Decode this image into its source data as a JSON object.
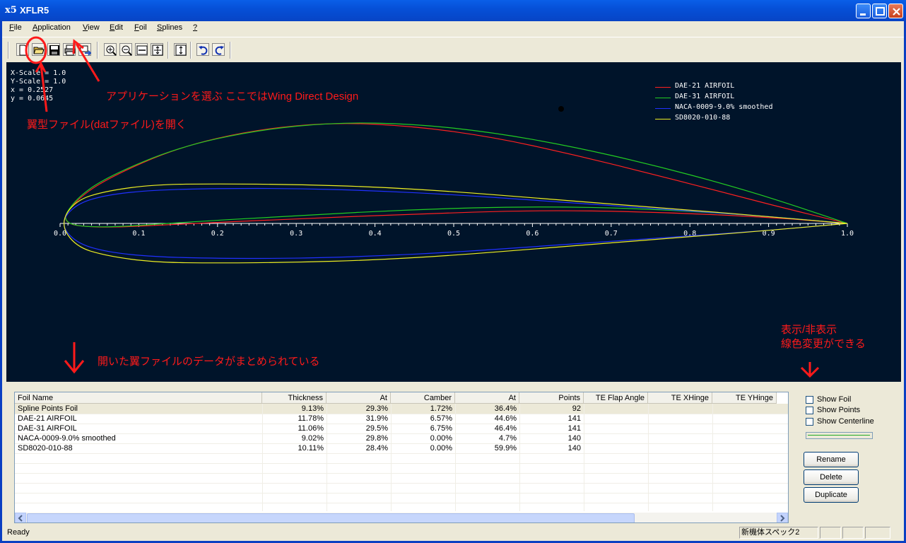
{
  "window": {
    "title": "XFLR5",
    "icon": "x5-app-icon"
  },
  "menu": [
    {
      "label": "File",
      "u": "F",
      "rest": "ile"
    },
    {
      "label": "Application",
      "u": "A",
      "rest": "pplication"
    },
    {
      "label": "View",
      "u": "V",
      "rest": "iew"
    },
    {
      "label": "Edit",
      "u": "E",
      "rest": "dit"
    },
    {
      "label": "Foil",
      "u": "F",
      "rest": "oil"
    },
    {
      "label": "Splines",
      "u": "S",
      "rest": "plines"
    },
    {
      "label": "?",
      "u": "?",
      "rest": ""
    }
  ],
  "toolbar_icons": [
    "new-icon",
    "open-icon",
    "save-icon",
    "print-icon",
    "export-icon",
    "zoom-in-icon",
    "zoom-out-icon",
    "zoom-less-icon",
    "reset-scale-icon",
    "y-scale-icon",
    "undo-icon",
    "redo-icon"
  ],
  "scale_info": {
    "line1": "X-Scale =  1.0",
    "line2": "Y-Scale =  1.0",
    "line3": "x  =  0.2527",
    "line4": "y  =  0.0645"
  },
  "chart_data": {
    "type": "line",
    "x_ticks": [
      "0.0",
      "0.1",
      "0.2",
      "0.3",
      "0.4",
      "0.5",
      "0.6",
      "0.7",
      "0.8",
      "0.9",
      "1.0"
    ],
    "xlim": [
      0,
      1
    ],
    "series": [
      {
        "name": "DAE-21 AIRFOIL",
        "color": "#FF2020",
        "upper": [
          [
            0,
            0
          ],
          [
            0.02,
            0.03
          ],
          [
            0.06,
            0.058
          ],
          [
            0.15,
            0.098
          ],
          [
            0.25,
            0.121
          ],
          [
            0.35,
            0.13
          ],
          [
            0.45,
            0.125
          ],
          [
            0.55,
            0.111
          ],
          [
            0.65,
            0.089
          ],
          [
            0.75,
            0.064
          ],
          [
            0.85,
            0.038
          ],
          [
            0.93,
            0.017
          ],
          [
            1,
            0
          ]
        ],
        "lower": [
          [
            0,
            0
          ],
          [
            0.05,
            -0.006
          ],
          [
            0.15,
            -0.001
          ],
          [
            0.3,
            0.006
          ],
          [
            0.45,
            0.012
          ],
          [
            0.6,
            0.017
          ],
          [
            0.75,
            0.015
          ],
          [
            0.9,
            0.008
          ],
          [
            1,
            0
          ]
        ]
      },
      {
        "name": "DAE-31 AIRFOIL",
        "color": "#22CC22",
        "upper": [
          [
            0,
            0
          ],
          [
            0.02,
            0.032
          ],
          [
            0.06,
            0.06
          ],
          [
            0.15,
            0.098
          ],
          [
            0.25,
            0.12
          ],
          [
            0.35,
            0.13
          ],
          [
            0.45,
            0.128
          ],
          [
            0.55,
            0.117
          ],
          [
            0.65,
            0.099
          ],
          [
            0.75,
            0.076
          ],
          [
            0.85,
            0.049
          ],
          [
            0.93,
            0.024
          ],
          [
            1,
            0
          ]
        ],
        "lower": [
          [
            0,
            0
          ],
          [
            0.05,
            -0.006
          ],
          [
            0.15,
            0.001
          ],
          [
            0.3,
            0.01
          ],
          [
            0.45,
            0.018
          ],
          [
            0.6,
            0.022
          ],
          [
            0.75,
            0.019
          ],
          [
            0.9,
            0.009
          ],
          [
            1,
            0
          ]
        ]
      },
      {
        "name": "NACA-0009-9.0% smoothed",
        "color": "#2030FF",
        "upper": [
          [
            0,
            0
          ],
          [
            0.02,
            0.025
          ],
          [
            0.06,
            0.037
          ],
          [
            0.12,
            0.043
          ],
          [
            0.2,
            0.045
          ],
          [
            0.3,
            0.045
          ],
          [
            0.4,
            0.042
          ],
          [
            0.5,
            0.037
          ],
          [
            0.6,
            0.03
          ],
          [
            0.7,
            0.023
          ],
          [
            0.8,
            0.016
          ],
          [
            0.9,
            0.009
          ],
          [
            1,
            0
          ]
        ],
        "lower": [
          [
            0,
            0
          ],
          [
            0.02,
            -0.025
          ],
          [
            0.06,
            -0.037
          ],
          [
            0.12,
            -0.043
          ],
          [
            0.2,
            -0.045
          ],
          [
            0.3,
            -0.045
          ],
          [
            0.4,
            -0.042
          ],
          [
            0.5,
            -0.037
          ],
          [
            0.6,
            -0.03
          ],
          [
            0.7,
            -0.023
          ],
          [
            0.8,
            -0.016
          ],
          [
            0.9,
            -0.009
          ],
          [
            1,
            0
          ]
        ]
      },
      {
        "name": "SD8020-010-88",
        "color": "#EEEE22",
        "upper": [
          [
            0,
            0
          ],
          [
            0.02,
            0.03
          ],
          [
            0.06,
            0.042
          ],
          [
            0.12,
            0.05
          ],
          [
            0.2,
            0.051
          ],
          [
            0.3,
            0.05
          ],
          [
            0.4,
            0.047
          ],
          [
            0.5,
            0.041
          ],
          [
            0.6,
            0.033
          ],
          [
            0.7,
            0.025
          ],
          [
            0.8,
            0.017
          ],
          [
            0.9,
            0.009
          ],
          [
            1,
            0
          ]
        ],
        "lower": [
          [
            0,
            0
          ],
          [
            0.02,
            -0.03
          ],
          [
            0.06,
            -0.042
          ],
          [
            0.12,
            -0.05
          ],
          [
            0.2,
            -0.051
          ],
          [
            0.3,
            -0.05
          ],
          [
            0.4,
            -0.047
          ],
          [
            0.5,
            -0.041
          ],
          [
            0.6,
            -0.033
          ],
          [
            0.7,
            -0.025
          ],
          [
            0.8,
            -0.017
          ],
          [
            0.9,
            -0.009
          ],
          [
            1,
            0
          ]
        ]
      }
    ]
  },
  "annotations": {
    "app_select": "アプリケーションを選ぶ  ここではWing Direct Design",
    "open_file": "翼型ファイル(datファイル)を開く",
    "data_summary": "開いた翼ファイルのデータがまとめられている",
    "toggle_line1": "表示/非表示",
    "toggle_line2": "線色変更ができる",
    "color": "#FF1A1A"
  },
  "table": {
    "headers": [
      "Foil Name",
      "Thickness",
      "At",
      "Camber",
      "At",
      "Points",
      "TE Flap Angle",
      "TE XHinge",
      "TE YHinge"
    ],
    "rows": [
      [
        "Spline Points Foil",
        "9.13%",
        "29.3%",
        "1.72%",
        "36.4%",
        "92",
        "",
        "",
        ""
      ],
      [
        "DAE-21 AIRFOIL",
        "11.78%",
        "31.9%",
        "6.57%",
        "44.6%",
        "141",
        "",
        "",
        ""
      ],
      [
        "DAE-31 AIRFOIL",
        "11.06%",
        "29.5%",
        "6.75%",
        "46.4%",
        "141",
        "",
        "",
        ""
      ],
      [
        "NACA-0009-9.0% smoothed",
        "9.02%",
        "29.8%",
        "0.00%",
        "4.7%",
        "140",
        "",
        "",
        ""
      ],
      [
        "SD8020-010-88",
        "10.11%",
        "28.4%",
        "0.00%",
        "59.9%",
        "140",
        "",
        "",
        ""
      ]
    ]
  },
  "options": {
    "show_foil": "Show Foil",
    "show_points": "Show Points",
    "show_centerline": "Show Centerline",
    "line_color": "#22AA22"
  },
  "buttons": {
    "rename": "Rename",
    "delete": "Delete",
    "duplicate": "Duplicate"
  },
  "status": {
    "text": "Ready",
    "project": "新機体スペック2"
  }
}
